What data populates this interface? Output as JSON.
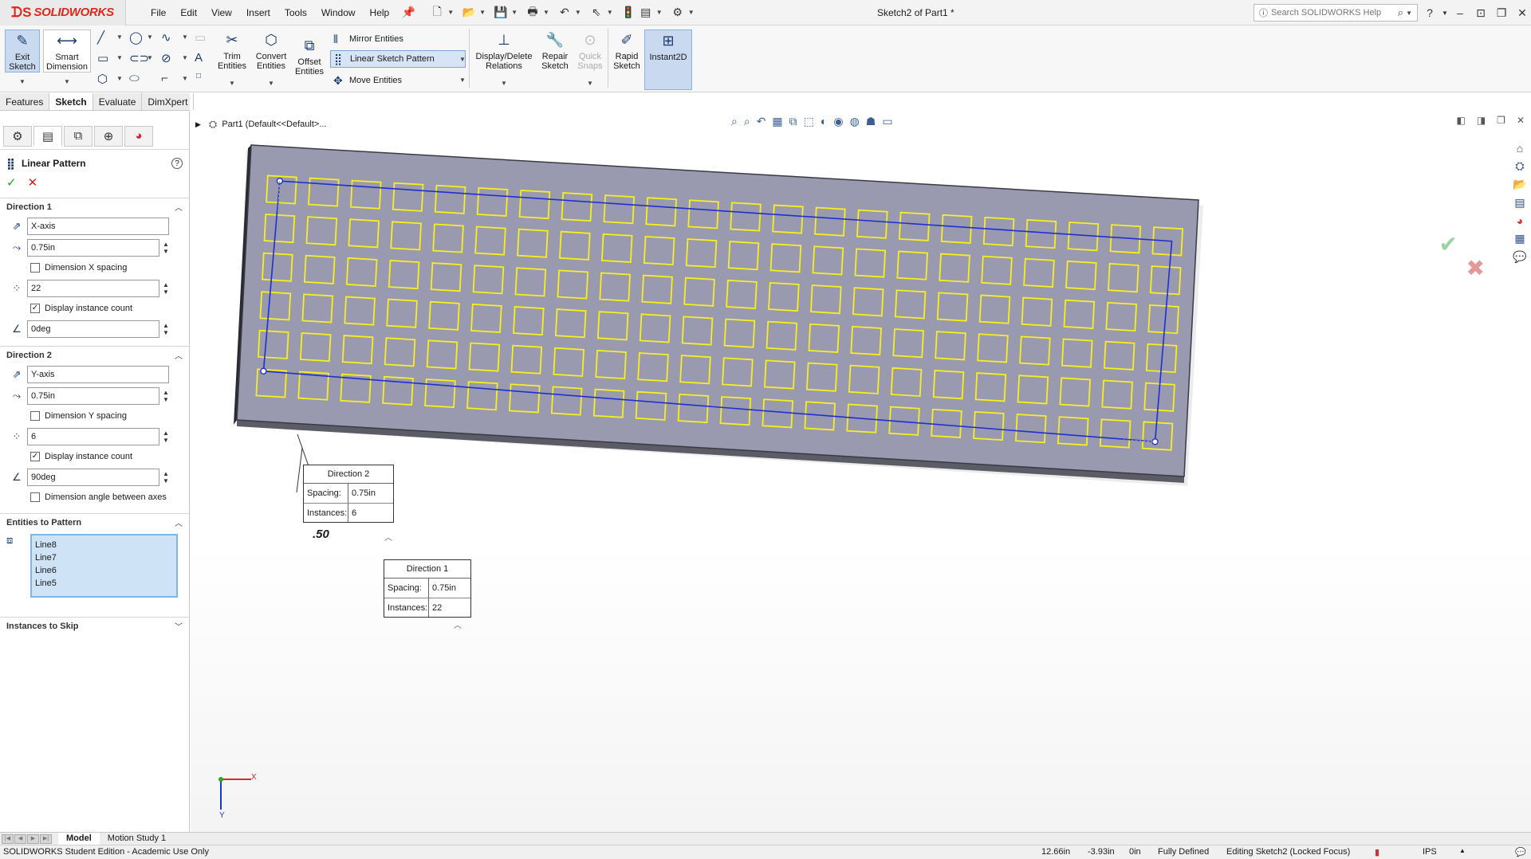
{
  "app": {
    "brand": "SOLIDWORKS",
    "document_title": "Sketch2 of Part1 *",
    "menu": [
      "File",
      "Edit",
      "View",
      "Insert",
      "Tools",
      "Window",
      "Help"
    ],
    "search_placeholder": "Search SOLIDWORKS Help"
  },
  "commands": {
    "exit_sketch": "Exit Sketch",
    "smart_dimension": "Smart Dimension",
    "trim_entities": "Trim Entities",
    "convert_entities": "Convert Entities",
    "offset_entities": "Offset Entities",
    "mirror_entities": "Mirror Entities",
    "linear_sketch_pattern": "Linear Sketch Pattern",
    "move_entities": "Move Entities",
    "display_delete_relations": "Display/Delete Relations",
    "repair_sketch": "Repair Sketch",
    "quick_snaps": "Quick Snaps",
    "rapid_sketch": "Rapid Sketch",
    "instant2d": "Instant2D"
  },
  "tabs": [
    "Features",
    "Sketch",
    "Evaluate",
    "DimXpert"
  ],
  "active_tab": "Sketch",
  "property_manager": {
    "title": "Linear Pattern",
    "direction1": {
      "header": "Direction 1",
      "axis": "X-axis",
      "spacing": "0.75in",
      "dimension_spacing_label": "Dimension X spacing",
      "dimension_spacing_checked": false,
      "instances": "22",
      "display_count_label": "Display instance count",
      "display_count_checked": true,
      "angle": "0deg"
    },
    "direction2": {
      "header": "Direction 2",
      "axis": "Y-axis",
      "spacing": "0.75in",
      "dimension_spacing_label": "Dimension Y spacing",
      "dimension_spacing_checked": false,
      "instances": "6",
      "display_count_label": "Display instance count",
      "display_count_checked": true,
      "angle": "90deg",
      "dimension_angle_label": "Dimension angle between axes",
      "dimension_angle_checked": false
    },
    "entities": {
      "header": "Entities to Pattern",
      "items": [
        "Line8",
        "Line7",
        "Line6",
        "Line5"
      ]
    },
    "instances_to_skip": "Instances to Skip"
  },
  "viewport": {
    "breadcrumb": "Part1  (Default<<Default>...",
    "pattern": {
      "columns": 22,
      "rows": 6
    },
    "callout_dir2": {
      "title": "Direction 2",
      "spacing_label": "Spacing:",
      "spacing": "0.75in",
      "instances_label": "Instances:",
      "instances": "6"
    },
    "callout_dir1": {
      "title": "Direction 1",
      "spacing_label": "Spacing:",
      "spacing": "0.75in",
      "instances_label": "Instances:",
      "instances": "22"
    },
    "dimension_label": ".50",
    "triad_x": "X",
    "triad_y": "Y"
  },
  "bottom_tabs": [
    "Model",
    "Motion Study 1"
  ],
  "active_bottom_tab": "Model",
  "status": {
    "edition": "SOLIDWORKS Student Edition - Academic Use Only",
    "x": "12.66in",
    "y": "-3.93in",
    "z": "0in",
    "state": "Fully Defined",
    "editing": "Editing Sketch2 (Locked Focus)",
    "units": "IPS"
  },
  "colors": {
    "sketch_yellow": "#f7ef1f",
    "plate_face": "#9999b0",
    "blue_line": "#1f2fd0",
    "brand_red": "#da291c"
  }
}
